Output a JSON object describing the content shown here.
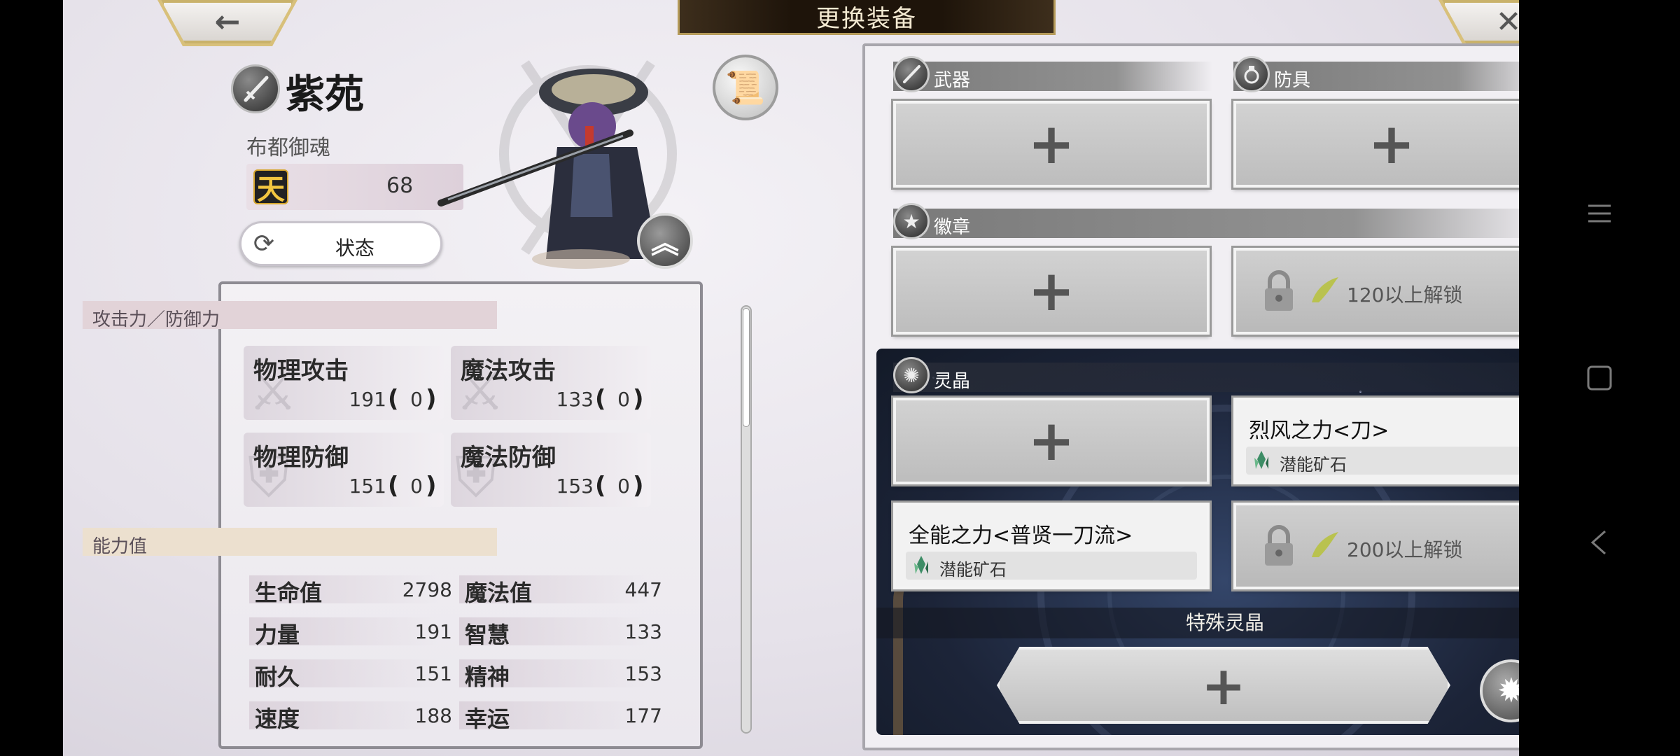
{
  "header": {
    "title": "更换装备",
    "back_icon": "←",
    "close_icon": "✕"
  },
  "character": {
    "name": "紫苑",
    "weapon_name": "布都御魂",
    "rank_glyph": "天",
    "level": "68",
    "status_label": "状态"
  },
  "stats": {
    "attack_defense_title": "攻击力／防御力",
    "combat": [
      {
        "name": "物理攻击",
        "value": "191",
        "bonus": "0"
      },
      {
        "name": "魔法攻击",
        "value": "133",
        "bonus": "0"
      },
      {
        "name": "物理防御",
        "value": "151",
        "bonus": "0"
      },
      {
        "name": "魔法防御",
        "value": "153",
        "bonus": "0"
      }
    ],
    "ability_title": "能力值",
    "abilities": [
      {
        "name": "生命值",
        "value": "2798"
      },
      {
        "name": "魔法值",
        "value": "447"
      },
      {
        "name": "力量",
        "value": "191"
      },
      {
        "name": "智慧",
        "value": "133"
      },
      {
        "name": "耐久",
        "value": "151"
      },
      {
        "name": "精神",
        "value": "153"
      },
      {
        "name": "速度",
        "value": "188"
      },
      {
        "name": "幸运",
        "value": "177"
      }
    ]
  },
  "equipment": {
    "weapon_label": "武器",
    "armor_label": "防具",
    "badge_label": "徽章",
    "badge_locked_text": "120以上解锁",
    "crystal_label": "灵晶",
    "crystal_slots": [
      {
        "name": "烈风之力<刀>",
        "type": "潜能矿石"
      },
      {
        "name": "全能之力<普贤一刀流>",
        "type": "潜能矿石"
      }
    ],
    "crystal_locked_text": "200以上解锁",
    "special_crystal_label": "特殊灵晶",
    "plus": "+"
  },
  "colors": {
    "title_bar": "#1e140a",
    "gold": "#c9b26a",
    "crystal_bg": "#1c2438"
  }
}
